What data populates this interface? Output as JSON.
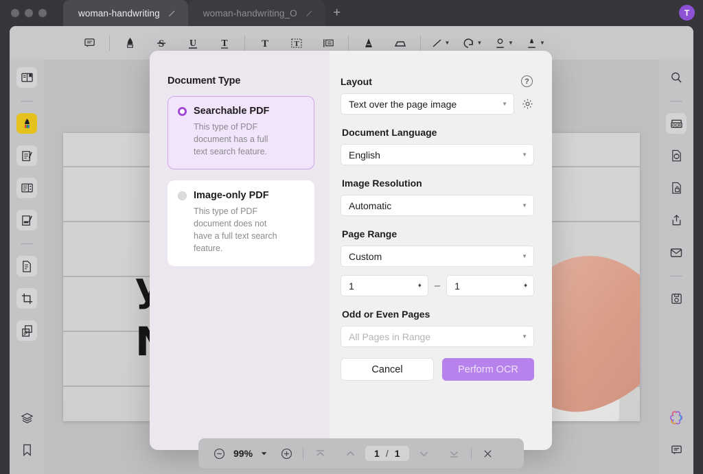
{
  "window": {
    "traffic_lights": [
      "close",
      "minimize",
      "maximize"
    ],
    "avatar_initial": "T",
    "accent_purple": "#a14ad8",
    "primary_button_color": "#b782ec"
  },
  "tabs": [
    {
      "label": "woman-handwriting",
      "active": true,
      "edit_icon": "pencil-icon"
    },
    {
      "label": "woman-handwriting_O",
      "active": false,
      "edit_icon": "pencil-icon"
    }
  ],
  "new_tab_label": "+",
  "toolbar": {
    "items": [
      {
        "name": "comment-icon",
        "glyph": ""
      },
      {
        "name": "highlighter-pen-icon",
        "glyph": ""
      },
      {
        "name": "strikethrough-icon",
        "glyph": "S"
      },
      {
        "name": "underline-icon",
        "glyph": "U"
      },
      {
        "name": "text-tool-icon",
        "glyph": "T"
      },
      {
        "name": "text-box-icon",
        "glyph": "T"
      },
      {
        "name": "text-field-icon",
        "glyph": "T"
      },
      {
        "name": "note-list-icon",
        "glyph": ""
      },
      {
        "name": "pen-tool-icon",
        "glyph": "A"
      },
      {
        "name": "eraser-icon",
        "glyph": ""
      },
      {
        "name": "line-tool-icon",
        "glyph": ""
      },
      {
        "name": "shape-tool-icon",
        "glyph": ""
      },
      {
        "name": "stamp-icon",
        "glyph": ""
      },
      {
        "name": "signature-icon",
        "glyph": ""
      }
    ]
  },
  "left_rail": {
    "items": [
      {
        "name": "read-mode-icon"
      },
      {
        "name": "highlight-tool-icon",
        "highlighted": true
      },
      {
        "name": "annotate-icon"
      },
      {
        "name": "page-layout-icon"
      },
      {
        "name": "fill-sign-icon"
      },
      {
        "name": "organize-pages-icon"
      },
      {
        "name": "crop-page-icon"
      },
      {
        "name": "compare-pages-icon"
      },
      {
        "name": "layers-icon"
      },
      {
        "name": "bookmark-icon"
      }
    ]
  },
  "right_rail": {
    "items": [
      {
        "name": "search-icon"
      },
      {
        "name": "ocr-icon",
        "active": true
      },
      {
        "name": "convert-icon"
      },
      {
        "name": "protect-document-icon"
      },
      {
        "name": "share-icon"
      },
      {
        "name": "email-icon"
      },
      {
        "name": "save-icon"
      },
      {
        "name": "ai-assistant-icon"
      },
      {
        "name": "comments-panel-icon"
      }
    ]
  },
  "document": {
    "handwriting_lines": [
      "ya",
      "N"
    ]
  },
  "dialog": {
    "document_type": {
      "title": "Document Type",
      "options": [
        {
          "title": "Searchable PDF",
          "description": "This type of PDF document has a full text search feature.",
          "selected": true
        },
        {
          "title": "Image-only PDF",
          "description": "This type of PDF document does not have a full text search feature.",
          "selected": false
        }
      ]
    },
    "layout": {
      "label": "Layout",
      "value": "Text over the page image",
      "help_icon": "question-mark-icon",
      "settings_icon": "gear-icon"
    },
    "document_language": {
      "label": "Document Language",
      "value": "English"
    },
    "image_resolution": {
      "label": "Image Resolution",
      "value": "Automatic"
    },
    "page_range": {
      "label": "Page Range",
      "value": "Custom",
      "from": "1",
      "to": "1",
      "separator": "–"
    },
    "odd_even": {
      "label": "Odd or Even Pages",
      "placeholder": "All Pages in Range"
    },
    "buttons": {
      "cancel": "Cancel",
      "confirm": "Perform OCR"
    }
  },
  "bottom_bar": {
    "zoom_out": "zoom-out-icon",
    "zoom_level": "99%",
    "zoom_dropdown": "chevron-down-icon",
    "zoom_in": "zoom-in-icon",
    "first_page": "first-page-icon",
    "prev_page": "previous-page-icon",
    "current_page": "1",
    "page_separator": "/",
    "total_pages": "1",
    "next_page": "next-page-icon",
    "last_page": "last-page-icon",
    "close": "close-icon"
  }
}
